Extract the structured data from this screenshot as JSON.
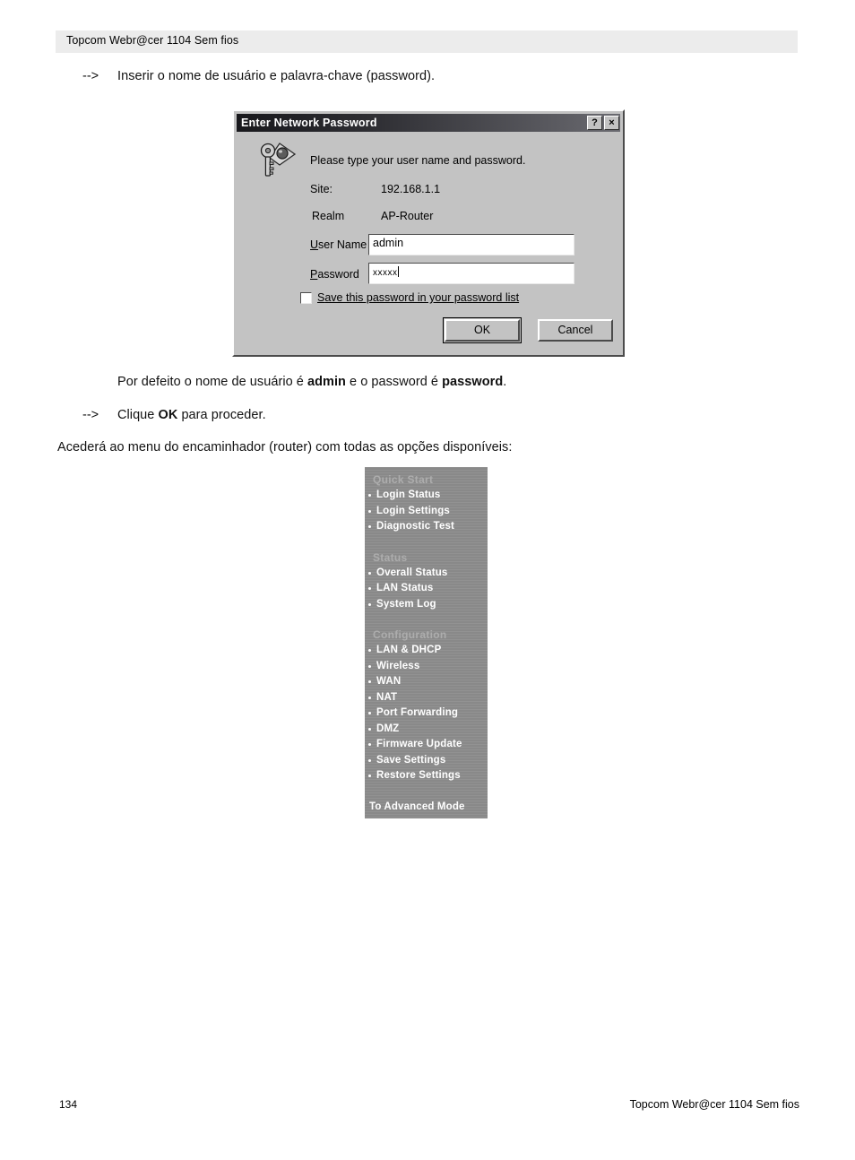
{
  "page": {
    "header_title": "Topcom  Webr@cer 1104 Sem fios",
    "footer_page_number": "134",
    "footer_title": "Topcom  Webr@cer 1104 Sem fios"
  },
  "instructions": {
    "step1_marker": "-->",
    "step1_text": "Inserir o nome de usuário e palavra-chave (password).",
    "default_note_prefix": "Por defeito o nome de usuário é ",
    "default_note_user": "admin",
    "default_note_middle": " e o password é ",
    "default_note_password": "password",
    "default_note_suffix": ".",
    "step2_marker": "-->",
    "step2_prefix": "Clique ",
    "step2_bold": "OK",
    "step2_suffix": " para proceder.",
    "result_text": "Acederá ao menu do encaminhador (router) com todas as opções disponíveis:"
  },
  "dialog": {
    "title": "Enter Network Password",
    "help_button": "?",
    "close_button": "×",
    "prompt": "Please type your user name and password.",
    "site_label": "Site:",
    "site_value": "192.168.1.1",
    "realm_label": "Realm",
    "realm_value": "AP-Router",
    "username_label_accel": "U",
    "username_label_rest": "ser Name",
    "username_value": "admin",
    "password_label_accel": "P",
    "password_label_rest": "assword",
    "password_value": "xxxxx",
    "save_checkbox_accel": "S",
    "save_checkbox_rest": "ave this password in your password list",
    "save_checkbox_checked": false,
    "ok_button": "OK",
    "cancel_button": "Cancel"
  },
  "router_menu": {
    "sections": [
      {
        "heading": "Quick Start",
        "items": [
          "Login Status",
          "Login Settings",
          "Diagnostic Test"
        ]
      },
      {
        "heading": "Status",
        "items": [
          "Overall Status",
          "LAN Status",
          "System Log"
        ]
      },
      {
        "heading": "Configuration",
        "items": [
          "LAN & DHCP",
          "Wireless",
          "WAN",
          "NAT",
          "Port Forwarding",
          "DMZ",
          "Firmware Update",
          "Save Settings",
          "Restore Settings"
        ]
      }
    ],
    "advanced_link": "To Advanced Mode",
    "colors": {
      "background": "#8d8d8d",
      "heading_text": "#adadad",
      "item_text": "#ffffff"
    }
  }
}
